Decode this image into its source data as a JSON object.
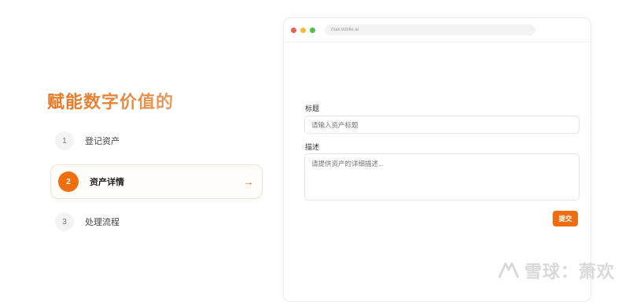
{
  "headline": "赋能数字价值的",
  "steps": [
    {
      "number": "1",
      "label": "登记资产",
      "active": false
    },
    {
      "number": "2",
      "label": "资产详情",
      "active": true
    },
    {
      "number": "3",
      "label": "处理流程",
      "active": false
    }
  ],
  "active_arrow": "→",
  "browser": {
    "url": "max.vobile.ai"
  },
  "form": {
    "title_label": "标题",
    "title_placeholder": "请输入资产标题",
    "description_label": "描述",
    "description_placeholder": "请提供资产的详细描述...",
    "submit_label": "提交"
  },
  "watermark": {
    "text": "雪球：萧欢"
  },
  "colors": {
    "accent": "#ef6d10",
    "headline_gradient_start": "#e8731c",
    "headline_gradient_end": "#e59a5c"
  }
}
